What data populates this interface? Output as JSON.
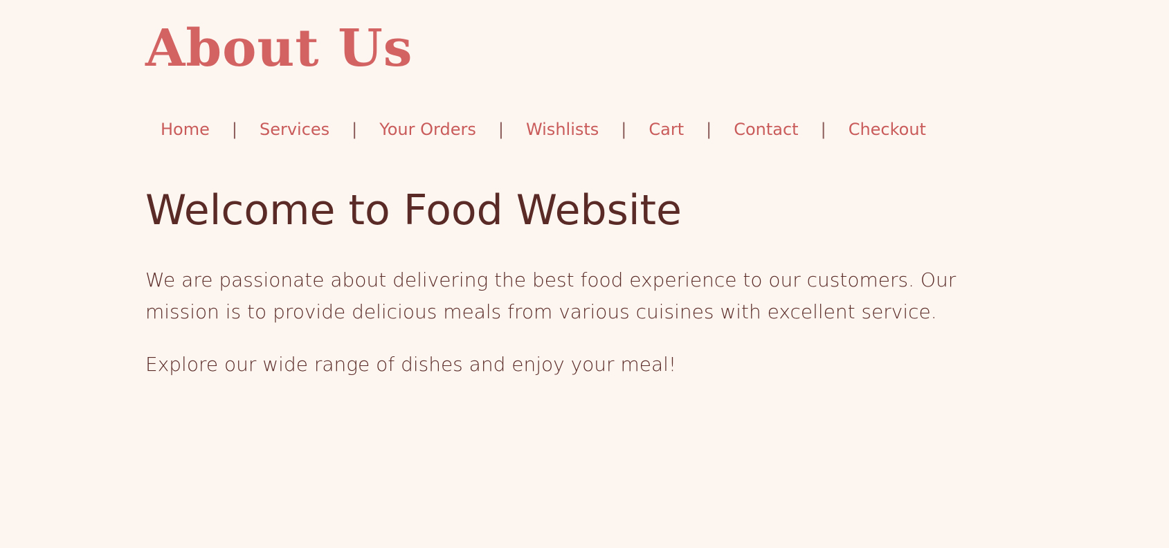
{
  "header": {
    "title": "About Us"
  },
  "nav": {
    "items": [
      {
        "label": "Home"
      },
      {
        "label": "Services"
      },
      {
        "label": "Your Orders"
      },
      {
        "label": "Wishlists"
      },
      {
        "label": "Cart"
      },
      {
        "label": "Contact"
      },
      {
        "label": "Checkout"
      }
    ],
    "separator": "|"
  },
  "main": {
    "heading": "Welcome to Food Website",
    "paragraphs": [
      "We are passionate about delivering the best food experience to our customers. Our mission is to provide delicious meals from various cuisines with excellent service.",
      "Explore our wide range of dishes and enjoy your meal!"
    ]
  },
  "colors": {
    "background": "#fdf6f0",
    "accent": "#d36363",
    "text": "#5a2a27"
  }
}
